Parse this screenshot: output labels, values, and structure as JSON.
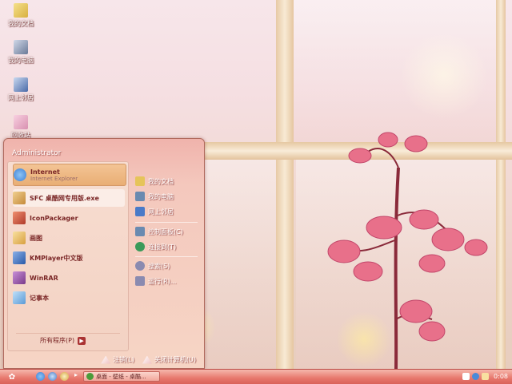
{
  "desktop_icons": [
    {
      "label": "我的文档",
      "icon": "folder-documents-icon"
    },
    {
      "label": "我的电脑",
      "icon": "computer-icon"
    },
    {
      "label": "网上邻居",
      "icon": "network-icon"
    },
    {
      "label": "回收站",
      "icon": "recycle-bin-icon"
    }
  ],
  "start_menu": {
    "user": "Administrator",
    "pinned": [
      {
        "title": "Internet",
        "subtitle": "Internet Explorer",
        "icon": "ie-icon",
        "color": "#3b7fd6"
      }
    ],
    "recent": [
      {
        "title": "SFC 桌酷网专用版.exe",
        "icon": "sfc-icon",
        "color": "#c58a3a"
      },
      {
        "title": "IconPackager",
        "icon": "iconpackager-icon",
        "color": "#b03a2a"
      },
      {
        "title": "画图",
        "icon": "paint-icon",
        "color": "#d8a040"
      },
      {
        "title": "KMPlayer中文版",
        "icon": "kmplayer-icon",
        "color": "#2a5aa8"
      },
      {
        "title": "WinRAR",
        "icon": "winrar-icon",
        "color": "#7a3a8a"
      },
      {
        "title": "记事本",
        "icon": "notepad-icon",
        "color": "#5a9ad6"
      }
    ],
    "all_programs": "所有程序(P)",
    "right": [
      {
        "label": "我的文档",
        "icon": "documents-icon",
        "color": "#e6c45a"
      },
      {
        "label": "我的电脑",
        "icon": "computer-icon",
        "color": "#6a8ab0"
      },
      {
        "label": "网上邻居",
        "icon": "network-icon",
        "color": "#4a7ac8"
      },
      {
        "label": "控制面板(C)",
        "icon": "control-panel-icon",
        "color": "#6a8ab0"
      },
      {
        "label": "连接到(T)",
        "icon": "connect-icon",
        "color": "#3a9a5a"
      },
      {
        "label": "搜索(S)",
        "icon": "search-icon",
        "color": "#8a8ab0"
      },
      {
        "label": "运行(R)...",
        "icon": "run-icon",
        "color": "#8a8ab0"
      }
    ],
    "logoff": "注销(L)",
    "shutdown": "关闭计算机(U)"
  },
  "taskbar": {
    "task_label": "桌面 - 壁纸 - 桌酷...",
    "clock": "0:08"
  }
}
